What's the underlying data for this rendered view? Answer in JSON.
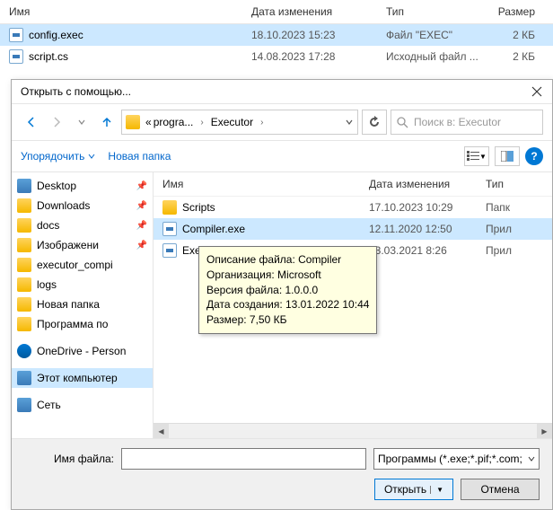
{
  "bg": {
    "headers": {
      "name": "Имя",
      "date": "Дата изменения",
      "type": "Тип",
      "size": "Размер"
    },
    "rows": [
      {
        "name": "config.exec",
        "date": "18.10.2023 15:23",
        "type": "Файл \"EXEC\"",
        "size": "2 КБ",
        "selected": true,
        "iconType": "exe"
      },
      {
        "name": "script.cs",
        "date": "14.08.2023 17:28",
        "type": "Исходный файл ...",
        "size": "2 КБ",
        "selected": false,
        "iconType": "cs"
      }
    ]
  },
  "dialog": {
    "title": "Открыть с помощью...",
    "breadcrumb": {
      "folder1": "progra...",
      "folder2": "Executor"
    },
    "search_placeholder": "Поиск в: Executor",
    "toolbar": {
      "organize": "Упорядочить",
      "new_folder": "Новая папка"
    },
    "tree": [
      {
        "label": "Desktop",
        "icon": "pc",
        "pinned": true
      },
      {
        "label": "Downloads",
        "icon": "folder",
        "pinned": true
      },
      {
        "label": "docs",
        "icon": "folder",
        "pinned": true
      },
      {
        "label": "Изображени",
        "icon": "folder",
        "pinned": true
      },
      {
        "label": "executor_compi",
        "icon": "folder"
      },
      {
        "label": "logs",
        "icon": "folder"
      },
      {
        "label": "Новая папка",
        "icon": "folder"
      },
      {
        "label": "Программа по ",
        "icon": "folder"
      },
      {
        "label": "OneDrive - Person",
        "icon": "cloud",
        "spacer": true
      },
      {
        "label": "Этот компьютер",
        "icon": "pc",
        "selected": true,
        "spacer": true
      },
      {
        "label": "Сеть",
        "icon": "network",
        "spacer": true
      }
    ],
    "list_headers": {
      "name": "Имя",
      "date": "Дата изменения",
      "type": "Тип"
    },
    "list": [
      {
        "name": "Scripts",
        "date": "17.10.2023 10:29",
        "type": "Папк",
        "icon": "folder"
      },
      {
        "name": "Compiler.exe",
        "date": "12.11.2020 12:50",
        "type": "Прил",
        "icon": "exe",
        "selected": true
      },
      {
        "name": "Executo",
        "date": "23.03.2021 8:26",
        "type": "Прил",
        "icon": "exe"
      }
    ],
    "tooltip": {
      "l1": "Описание файла: Compiler",
      "l2": "Организация: Microsoft",
      "l3": "Версия файла: 1.0.0.0",
      "l4": "Дата создания: 13.01.2022 10:44",
      "l5": "Размер: 7,50 КБ"
    },
    "bottom": {
      "filename_label": "Имя файла:",
      "filename_value": "",
      "filetype": "Программы (*.exe;*.pif;*.com;",
      "open": "Открыть",
      "cancel": "Отмена"
    }
  }
}
